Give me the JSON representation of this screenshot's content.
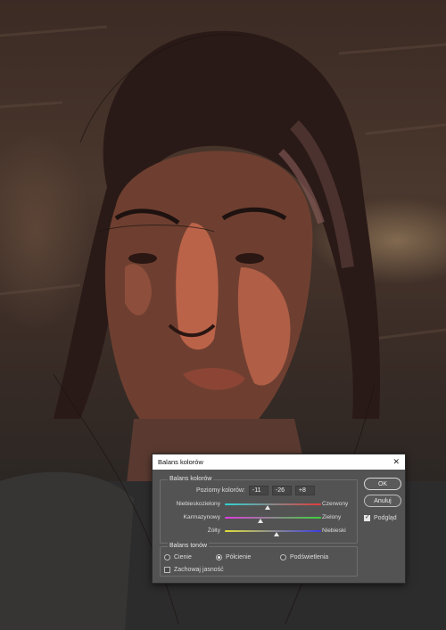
{
  "dialog": {
    "title": "Balans kolorów",
    "close_glyph": "✕",
    "balance_group": {
      "title": "Balans kolorów",
      "levels_label": "Poziomy kolorów:",
      "levels": [
        "-11",
        "-26",
        "+8"
      ],
      "sliders": [
        {
          "left": "Niebieskozielony",
          "right": "Czerwony",
          "value": -11,
          "track_colors": [
            "#2fd3d3",
            "#e23b3b"
          ],
          "icon": "slider-thumb"
        },
        {
          "left": "Karmazynowy",
          "right": "Zielony",
          "value": -26,
          "track_colors": [
            "#e03be0",
            "#3bd33b"
          ],
          "icon": "slider-thumb"
        },
        {
          "left": "Żółty",
          "right": "Niebieski",
          "value": 8,
          "track_colors": [
            "#e0e03b",
            "#3b3be6"
          ],
          "icon": "slider-thumb"
        }
      ],
      "range": [
        -100,
        100
      ]
    },
    "tones_group": {
      "title": "Balans tonów",
      "options": [
        {
          "label": "Cienie",
          "checked": false
        },
        {
          "label": "Półcienie",
          "checked": true
        },
        {
          "label": "Podświetlenia",
          "checked": false
        }
      ],
      "preserve_luminosity": {
        "label": "Zachowaj jasność",
        "checked": false
      }
    },
    "buttons": {
      "ok": "OK",
      "cancel": "Anuluj"
    },
    "preview": {
      "label": "Podgląd",
      "checked": true
    }
  }
}
